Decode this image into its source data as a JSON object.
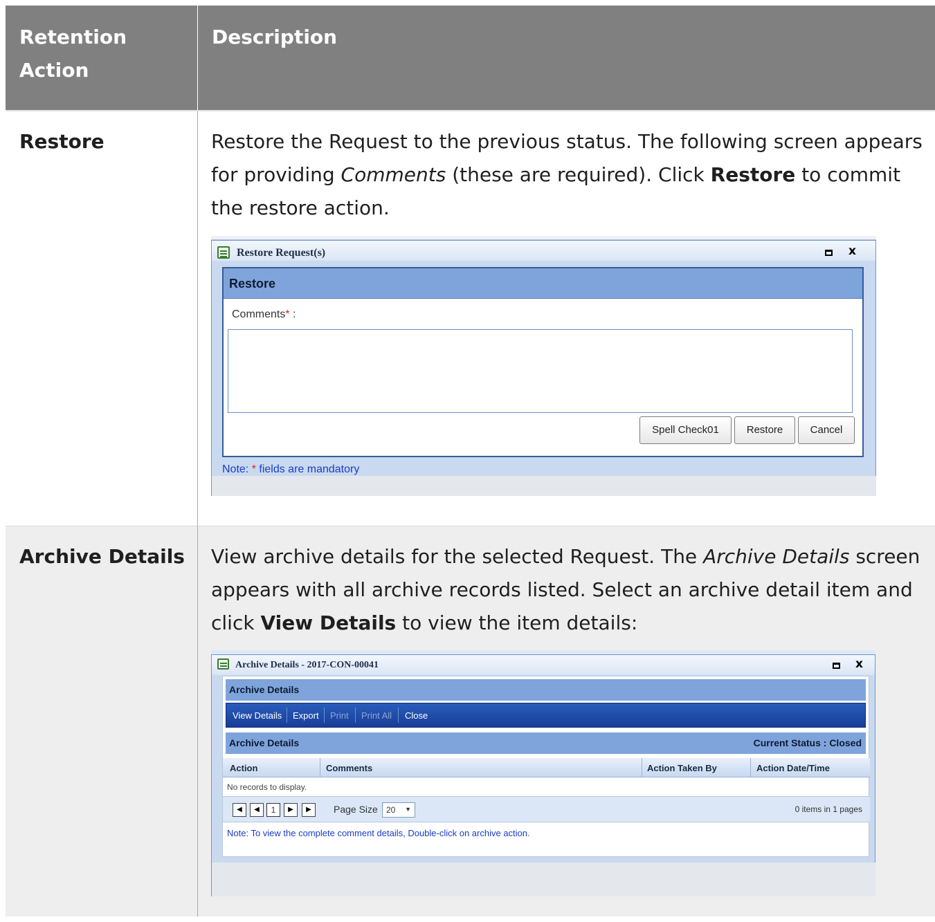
{
  "table": {
    "headers": {
      "action": "Retention Action",
      "description": "Description"
    },
    "rows": [
      {
        "action": "Restore",
        "desc": {
          "p1": "Restore the Request to the previous status. The following screen appears for providing ",
          "i1": "Comments",
          "p2": " (these are required). Click ",
          "b1": "Restore",
          "p3": " to commit the restore action."
        }
      },
      {
        "action": "Archive Details",
        "desc": {
          "p1": "View archive details for the selected Request. The ",
          "i1": "Archive Details",
          "p2": " screen appears with all archive records listed. Select an archive detail item and click ",
          "b1": "View Details",
          "p3": " to view the item details:"
        }
      }
    ]
  },
  "restore_dialog": {
    "title": "Restore Request(s)",
    "panel_title": "Restore",
    "comments_label": "Comments",
    "required_mark": "*",
    "label_suffix": " :",
    "comments_value": "",
    "buttons": {
      "spell_check": "Spell Check01",
      "restore": "Restore",
      "cancel": "Cancel"
    },
    "note_prefix": "Note: ",
    "note_suffix": " fields are mandatory"
  },
  "archive_dialog": {
    "title": "Archive Details - 2017-CON-00041",
    "panel_title": "Archive Details",
    "toolbar": {
      "view_details": "View Details",
      "export": "Export",
      "print": "Print",
      "print_all": "Print All",
      "close": "Close"
    },
    "sub_title": "Archive Details",
    "current_status": "Current Status : Closed",
    "columns": {
      "action": "Action",
      "comments": "Comments",
      "taken_by": "Action Taken By",
      "date_time": "Action Date/Time"
    },
    "empty_message": "No records to display.",
    "pager": {
      "current_page": "1",
      "page_size_label": "Page Size",
      "page_size": "20",
      "items_text": "0 items in 1 pages"
    },
    "note": "Note: To view the complete comment details, Double-click on archive action."
  },
  "colors": {
    "header_bg": "#808080",
    "panel_blue": "#7ea4db",
    "toolbar_blue": "#1f4aa8",
    "note_blue": "#1a3cc8",
    "required_red": "#e32020"
  },
  "icons": {
    "window_icon": "list-window-icon",
    "maximize": "maximize-icon",
    "close": "close-icon",
    "pager": [
      "first-page-icon",
      "prev-page-icon",
      "next-page-icon",
      "last-page-icon"
    ]
  }
}
